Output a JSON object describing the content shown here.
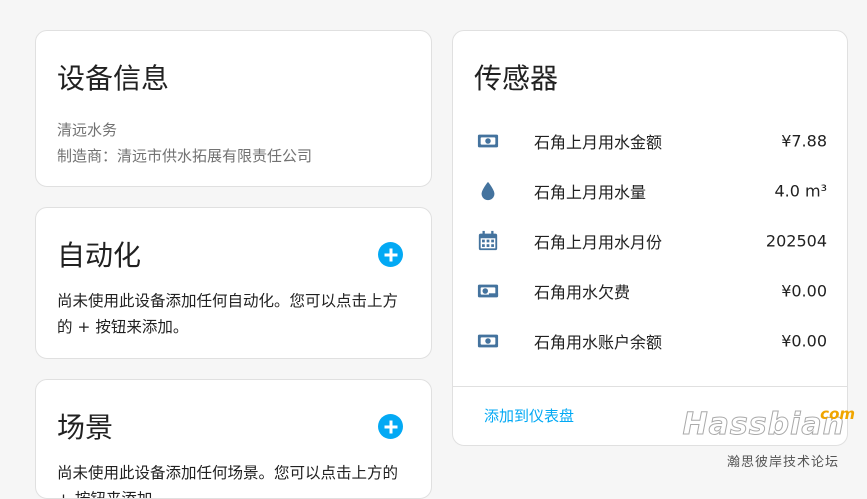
{
  "device_info": {
    "title": "设备信息",
    "model": "清远水务",
    "manufacturer": "制造商：清远市供水拓展有限责任公司"
  },
  "automation": {
    "title": "自动化",
    "hint": "尚未使用此设备添加任何自动化。您可以点击上方的 + 按钮来添加。"
  },
  "scenes": {
    "title": "场景",
    "hint": "尚未使用此设备添加任何场景。您可以点击上方的 + 按钮来添加。"
  },
  "sensors": {
    "title": "传感器",
    "items": [
      {
        "icon": "cash-icon",
        "name": "石角上月用水金额",
        "value": "¥7.88"
      },
      {
        "icon": "water-icon",
        "name": "石角上月用水量",
        "value": "4.0 m³"
      },
      {
        "icon": "calendar-icon",
        "name": "石角上月用水月份",
        "value": "202504"
      },
      {
        "icon": "cash-minus-icon",
        "name": "石角用水欠费",
        "value": "¥0.00"
      },
      {
        "icon": "cash-icon",
        "name": "石角用水账户余额",
        "value": "¥0.00"
      }
    ],
    "add_to_dashboard": "添加到仪表盘"
  },
  "watermark": {
    "logo": "Hassbian",
    "suffix": "com",
    "subtitle": "瀚思彼岸技术论坛"
  },
  "colors": {
    "accent": "#03a9f4",
    "icon": "#44739e",
    "secondary_text": "#727272"
  }
}
